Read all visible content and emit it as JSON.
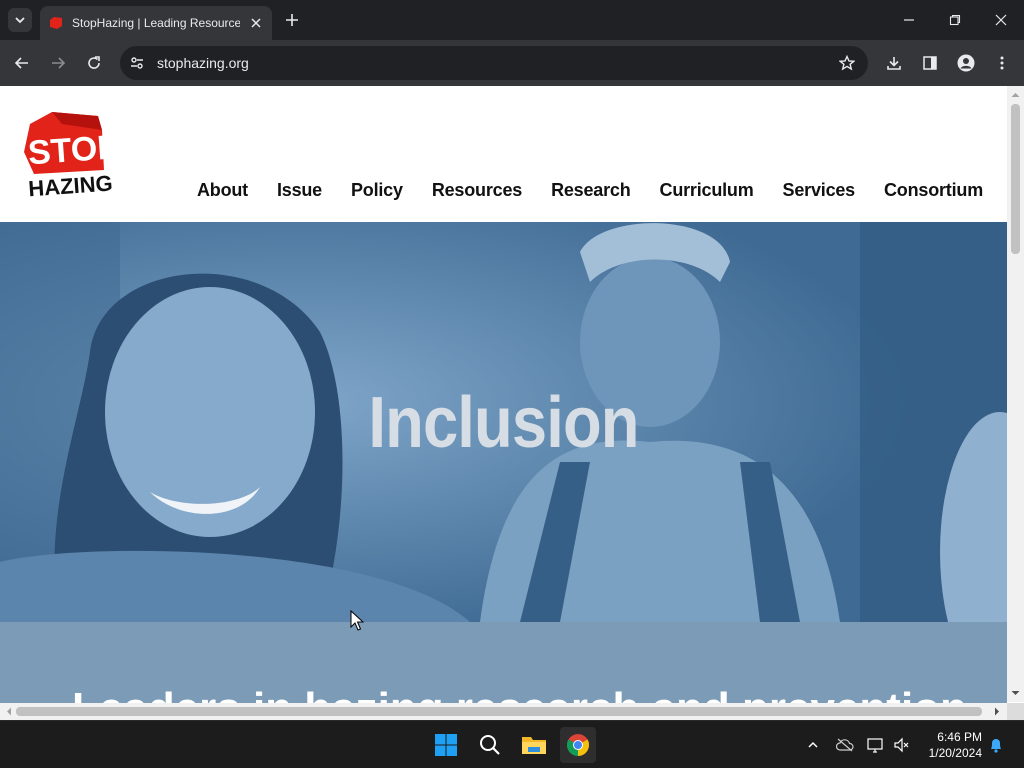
{
  "browser": {
    "tab_title": "StopHazing | Leading Resource",
    "url": "stophazing.org"
  },
  "site": {
    "logo": {
      "line1": "STOP",
      "line2": "HAZING"
    },
    "nav": [
      "About",
      "Issue",
      "Policy",
      "Resources",
      "Research",
      "Curriculum",
      "Services",
      "Consortium"
    ],
    "hero_word": "Inclusion",
    "band_heading": "Leaders in hazing research and prevention"
  },
  "taskbar": {
    "time": "6:46 PM",
    "date": "1/20/2024"
  },
  "colors": {
    "hero_tint": "#4f7ea9",
    "band": "#7c9bb6",
    "logo_red": "#e2231a"
  }
}
